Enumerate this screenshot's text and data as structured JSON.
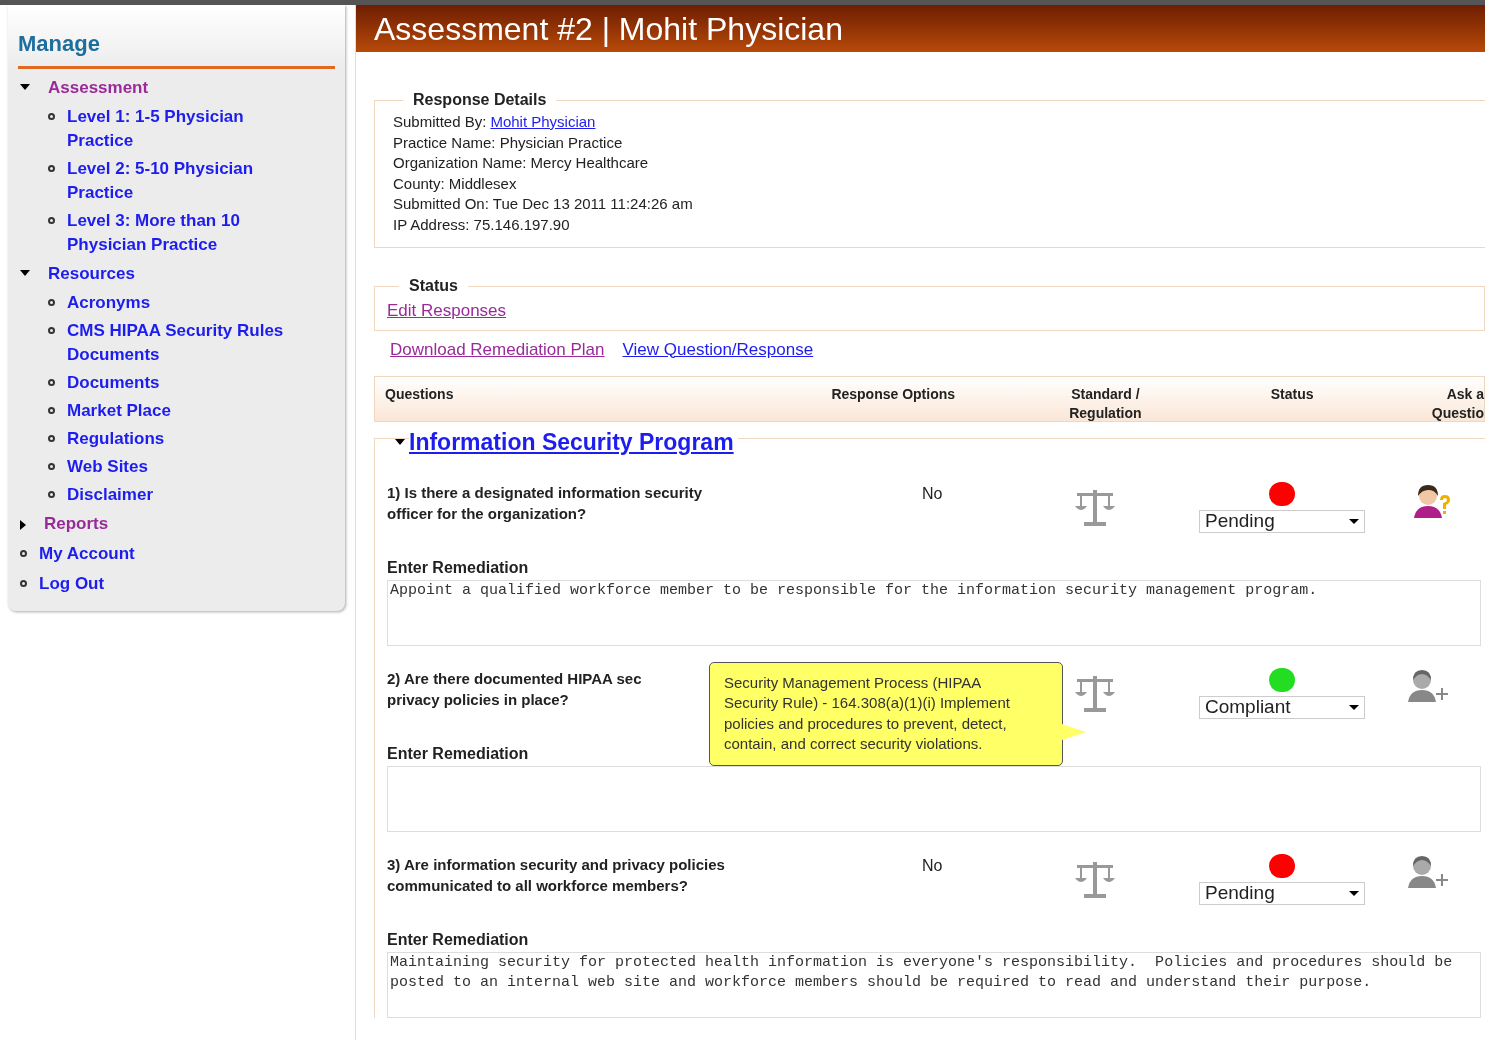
{
  "sidebar": {
    "title": "Manage",
    "items": [
      {
        "label": "Assessment",
        "kind": "folder",
        "expanded": true,
        "visited": true,
        "children": [
          {
            "label": "Level 1: 1-5 Physician Practice",
            "kind": "link",
            "visited": false
          },
          {
            "label": "Level 2: 5-10 Physician Practice",
            "kind": "link",
            "visited": false
          },
          {
            "label": "Level 3: More than 10 Physician Practice",
            "kind": "link",
            "visited": false
          }
        ]
      },
      {
        "label": "Resources",
        "kind": "folder",
        "expanded": true,
        "visited": false,
        "children": [
          {
            "label": "Acronyms",
            "kind": "link",
            "visited": false
          },
          {
            "label": "CMS HIPAA Security Rules Documents",
            "kind": "link",
            "visited": false
          },
          {
            "label": "Documents",
            "kind": "link",
            "visited": false
          },
          {
            "label": "Market Place",
            "kind": "link",
            "visited": false
          },
          {
            "label": "Regulations",
            "kind": "link",
            "visited": false
          },
          {
            "label": "Web Sites",
            "kind": "link",
            "visited": false
          },
          {
            "label": "Disclaimer",
            "kind": "link",
            "visited": false
          }
        ]
      },
      {
        "label": "Reports",
        "kind": "folder",
        "expanded": false,
        "visited": true
      },
      {
        "label": "My Account",
        "kind": "link",
        "visited": false
      },
      {
        "label": "Log Out",
        "kind": "link",
        "visited": false
      }
    ]
  },
  "page_title": "Assessment #2 | Mohit Physician",
  "response_details": {
    "legend": "Response Details",
    "submitted_by_label": "Submitted By:",
    "submitted_by": "Mohit Physician",
    "lines": [
      "Practice Name: Physician Practice",
      "Organization Name: Mercy Healthcare",
      "County: Middlesex",
      "Submitted On: Tue Dec 13 2011 11:24:26 am",
      "IP Address: 75.146.197.90"
    ]
  },
  "status": {
    "legend": "Status",
    "links": [
      {
        "label": "Edit Responses",
        "visited": true
      }
    ]
  },
  "links": [
    {
      "label": "Download Remediation Plan",
      "visited": true
    },
    {
      "label": "View Question/Response",
      "visited": false
    }
  ],
  "table": {
    "columns": [
      "Questions",
      "Response Options",
      "Standard / Regulation",
      "Status",
      "Ask a Questio"
    ]
  },
  "section": {
    "title": "Information Security Program",
    "expanded": true
  },
  "questions": [
    {
      "lines": [
        "1) Is there a designated information security",
        "officer for the organization?"
      ],
      "response": "No",
      "color": "#ff0000",
      "status": "Pending",
      "ask": {
        "kind": "question"
      },
      "remediation_label": "Enter Remediation",
      "remediation": "Appoint a qualified workforce member to be responsible for the information security management program."
    },
    {
      "lines": [
        "2) Are there documented HIPAA sec",
        "privacy policies in place?"
      ],
      "color": "#22dd22",
      "status": "Compliant",
      "ask": {
        "kind": "add"
      },
      "remediation_label": "Enter Remediation",
      "tooltip": "Security Management Process (HIPAA Security Rule) - 164.308(a)(1)(i) Implement policies and procedures to prevent, detect, contain, and correct security violations."
    },
    {
      "lines": [
        "3) Are information security and privacy policies",
        "communicated to all workforce members?"
      ],
      "response": "No",
      "color": "#ff0000",
      "status": "Pending",
      "ask": {
        "kind": "add"
      },
      "remediation_label": "Enter Remediation",
      "remediation": "Maintaining security for protected health information is everyone's responsibility.  Policies and procedures should be posted to an internal web site and workforce members should be required to read and understand their purpose."
    }
  ]
}
